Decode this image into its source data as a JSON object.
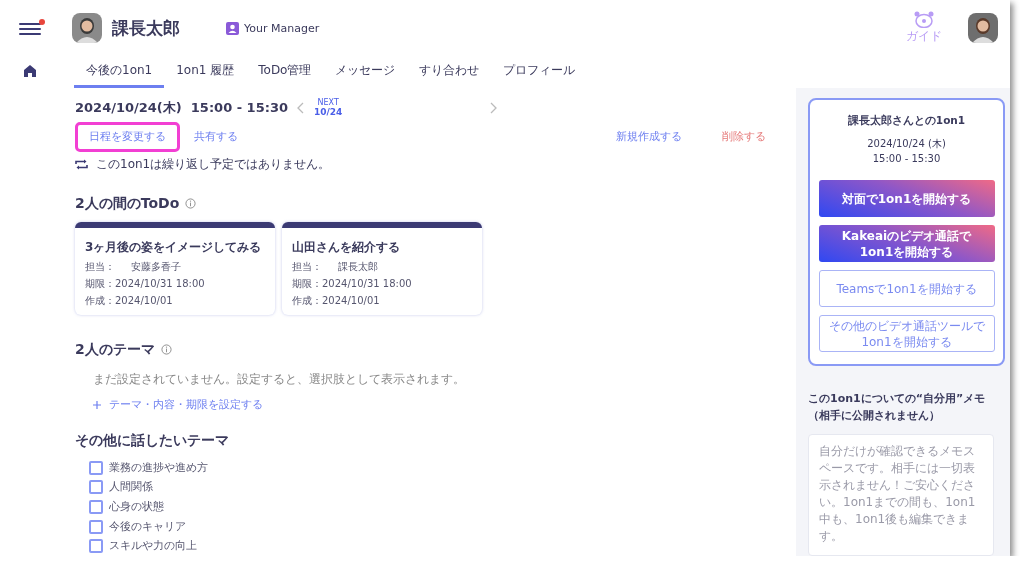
{
  "header": {
    "person_name": "課長太郎",
    "role_badge": "Your Manager",
    "guide_label": "ガイド",
    "notification_dot": true
  },
  "tabs": [
    {
      "label": "今後の1on1",
      "selected": true
    },
    {
      "label": "1on1 履歴",
      "selected": false
    },
    {
      "label": "ToDo管理",
      "selected": false
    },
    {
      "label": "メッセージ",
      "selected": false
    },
    {
      "label": "すり合わせ",
      "selected": false
    },
    {
      "label": "プロフィール",
      "selected": false
    }
  ],
  "schedule": {
    "datetime": "2024/10/24(木)  15:00 - 15:30",
    "next_label": "NEXT",
    "next_date": "10/24"
  },
  "actions": [
    {
      "label": "日程を変更する",
      "kind": "primary",
      "highlighted": true
    },
    {
      "label": "共有する",
      "kind": "primary",
      "highlighted": false
    },
    {
      "label": "新規作成する",
      "kind": "primary",
      "highlighted": false
    },
    {
      "label": "削除する",
      "kind": "danger",
      "highlighted": false
    }
  ],
  "recurrence_note": "この1on1は繰り返し予定ではありません。",
  "todo_section": {
    "title": "2人の間のToDo",
    "cards": [
      {
        "title": "3ヶ月後の姿をイメージしてみる",
        "assignee_label": "担当：",
        "assignee": "安藤多香子",
        "due": "期限：2024/10/31 18:00",
        "created": "作成：2024/10/01"
      },
      {
        "title": "山田さんを紹介する",
        "assignee_label": "担当：",
        "assignee": "課長太郎",
        "due": "期限：2024/10/31 18:00",
        "created": "作成：2024/10/01"
      }
    ]
  },
  "theme_section": {
    "title": "2人のテーマ",
    "empty_text": "まだ設定されていません。設定すると、選択肢として表示されます。",
    "add_link": "テーマ・内容・期限を設定する"
  },
  "other_topics": {
    "title": "その他に話したいテーマ",
    "items": [
      {
        "label": "業務の進捗や進め方",
        "checked": false
      },
      {
        "label": "人間関係",
        "checked": false
      },
      {
        "label": "心身の状態",
        "checked": false
      },
      {
        "label": "今後のキャリア",
        "checked": false
      },
      {
        "label": "スキルや力の向上",
        "checked": false
      }
    ]
  },
  "side_card": {
    "title": "課長太郎さんとの1on1",
    "date": "2024/10/24 (木)",
    "time": "15:00 - 15:30",
    "buttons": [
      {
        "label": "対面で1on1を開始する",
        "kind": "gradient"
      },
      {
        "label": "Kakeaiのビデオ通話で\n1on1を開始する",
        "kind": "gradient"
      },
      {
        "label": "Teamsで1on1を開始する",
        "kind": "outline"
      },
      {
        "label": "その他のビデオ通話ツールで\n1on1を開始する",
        "kind": "outline"
      }
    ]
  },
  "memo": {
    "title_lines": [
      "この1on1についての“自分用”メモ",
      "（相手に公開されません）"
    ],
    "placeholder": "自分だけが確認できるメモスペースです。相手には一切表示されません！ご安心ください。1on1までの間も、1on1中も、1on1後も編集できます。"
  }
}
